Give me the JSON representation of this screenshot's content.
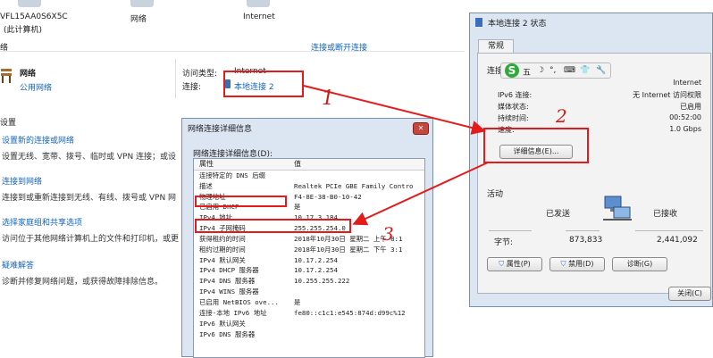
{
  "network_center": {
    "computer_name": "VFL15AA0S6X5C",
    "computer_sub": "(此计算机)",
    "network_label": "网络",
    "internet_label": "Internet",
    "section_network": "络",
    "connect_link": "连接或断开连接",
    "active_network": {
      "name": "网络",
      "type": "公用网络",
      "access_type_label": "访问类型:",
      "access_type_value": "Internet",
      "connection_label": "连接:",
      "connection_value": "本地连接 2"
    },
    "settings_header": "设置",
    "tasks": [
      {
        "title": "设置新的连接或网络",
        "desc": "设置无线、宽带、拨号、临时或 VPN 连接；或设"
      },
      {
        "title": "连接到网络",
        "desc": "连接到或重新连接到无线、有线、拨号或 VPN 网"
      },
      {
        "title": "选择家庭组和共享选项",
        "desc": "访问位于其他网络计算机上的文件和打印机，或更"
      },
      {
        "title": "疑难解答",
        "desc": "诊断并修复网络问题，或获得故障排除信息。"
      }
    ]
  },
  "status_window": {
    "title": "本地连接 2 状态",
    "tab": "常规",
    "connection_header": "连接",
    "rows": [
      {
        "key": "",
        "value": "Internet"
      },
      {
        "key": "IPv6 连接:",
        "value": "无 Internet 访问权限"
      },
      {
        "key": "媒体状态:",
        "value": "已启用"
      },
      {
        "key": "持续时间:",
        "value": "00:52:00"
      },
      {
        "key": "速度:",
        "value": "1.0 Gbps"
      }
    ],
    "details_button": "详细信息(E)...",
    "activity_header": "活动",
    "sent_label": "已发送",
    "received_label": "已接收",
    "bytes_label": "字节:",
    "bytes_sent": "873,833",
    "bytes_received": "2,441,092",
    "properties_button": "属性(P)",
    "disable_button": "禁用(D)",
    "diagnose_button": "诊断(G)",
    "close_button": "关闭(C)"
  },
  "ime_toolbar": {
    "logo": "S",
    "mode": "五",
    "items": [
      "☽",
      "°,",
      "⌨",
      "👕",
      "🔧"
    ]
  },
  "detail_window": {
    "title": "网络连接详细信息",
    "label": "网络连接详细信息(D):",
    "col_property": "属性",
    "col_value": "值",
    "rows": [
      {
        "p": "连接特定的 DNS 后缀",
        "v": ""
      },
      {
        "p": "描述",
        "v": "Realtek PCIe GBE Family Contro"
      },
      {
        "p": "物理地址",
        "v": "F4-8E-38-B0-10-42"
      },
      {
        "p": "已启用 DHCP",
        "v": "是"
      },
      {
        "p": "IPv4 地址",
        "v": "10.17.3.184"
      },
      {
        "p": "IPv4 子网掩码",
        "v": "255.255.254.0"
      },
      {
        "p": "获得租约的时间",
        "v": "2018年10月30日 星期二 上午 8:1"
      },
      {
        "p": "租约过期的时间",
        "v": "2018年10月30日 星期二 下午 3:1"
      },
      {
        "p": "IPv4 默认网关",
        "v": "10.17.2.254"
      },
      {
        "p": "IPv4 DHCP 服务器",
        "v": "10.17.2.254"
      },
      {
        "p": "IPv4 DNS 服务器",
        "v": "10.255.255.222"
      },
      {
        "p": "IPv4 WINS 服务器",
        "v": ""
      },
      {
        "p": "已启用 NetBIOS ove...",
        "v": "是"
      },
      {
        "p": "连接-本地 IPv6 地址",
        "v": "fe80::c1c1:e545:874d:d99c%12"
      },
      {
        "p": "IPv6 默认网关",
        "v": ""
      },
      {
        "p": "IPv6 DNS 服务器",
        "v": ""
      }
    ]
  },
  "annotations": [
    "1",
    "2",
    "3"
  ],
  "colors": {
    "accent_red": "#e41b1b",
    "link_blue": "#1565c0"
  }
}
